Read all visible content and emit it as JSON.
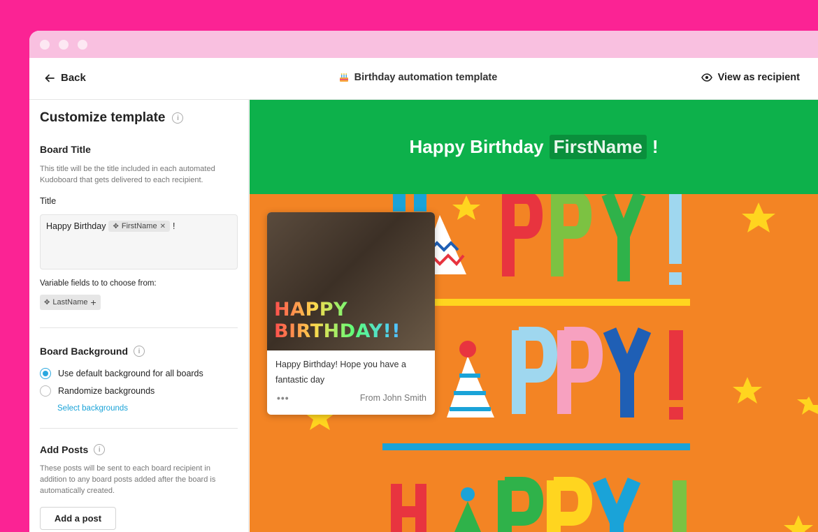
{
  "topbar": {
    "back_label": "Back",
    "title": "Birthday automation template",
    "view_as_label": "View as recipient"
  },
  "sidebar": {
    "heading": "Customize template",
    "board_title": {
      "label": "Board Title",
      "help": "This title will be the title included in each automated Kudoboard that gets delivered to each recipient.",
      "field_label": "Title",
      "value_prefix": "Happy Birthday",
      "value_chip": "FirstName",
      "value_suffix": "!",
      "variables_label": "Variable fields to to choose from:",
      "variable_chip": "LastName"
    },
    "board_background": {
      "label": "Board Background",
      "options": [
        {
          "label": "Use default background for all boards",
          "selected": true
        },
        {
          "label": "Randomize backgrounds",
          "selected": false
        }
      ],
      "select_link": "Select backgrounds"
    },
    "add_posts": {
      "label": "Add Posts",
      "help": "These posts will be sent to each board recipient in addition to any board posts added after the board is automatically created.",
      "button": "Add a post"
    }
  },
  "preview": {
    "header_prefix": "Happy Birthday",
    "header_var": "FirstName",
    "header_suffix": "!",
    "post": {
      "gif_text": "HAPPY BIRTHDAY!!",
      "message": "Happy Birthday! Hope you have a fantastic day",
      "from": "From John Smith"
    },
    "background_text": "HAPPY!"
  },
  "colors": {
    "page_bg": "#fb2394",
    "header_green": "#0db14b",
    "board_orange": "#f38424",
    "accent_blue": "#2aa7df"
  }
}
